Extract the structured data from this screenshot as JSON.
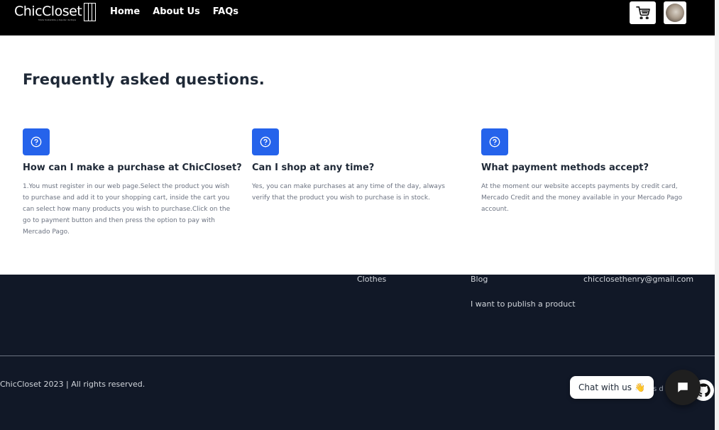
{
  "header": {
    "logo_text": "ChicCloset",
    "logo_subtitle": "Moda Sostenible y Alquiler de Ropa",
    "nav": [
      {
        "label": "Home"
      },
      {
        "label": "About Us"
      },
      {
        "label": "FAQs"
      }
    ],
    "cart_icon": "cart-icon",
    "avatar": "user-avatar"
  },
  "faq": {
    "title": "Frequently asked questions.",
    "items": [
      {
        "icon": "question-circle-icon",
        "question": "How can I make a purchase at ChicCloset?",
        "answer": "1.You must register in our web page.Select the product you wish to purchase and add it to your shopping cart, inside the cart you can select how many products you wish to purchase.Click on the go to payment button and then press the option to pay with Mercado Pago."
      },
      {
        "icon": "question-circle-icon",
        "question": "Can I shop at any time?",
        "answer": "Yes, you can make purchases at any time of the day, always verify that the product you wish to purchase is in stock."
      },
      {
        "icon": "question-circle-icon",
        "question": "What payment methods accept?",
        "answer": "At the moment our website accepts payments by credit card, Mercado Credit and the money available in your Mercado Pago account."
      }
    ]
  },
  "footer": {
    "links": {
      "clothes": "Clothes",
      "blog": "Blog",
      "publish": "I want to publish a product",
      "email": "chicclosethenry@gmail.com"
    },
    "copyright": "ChicCloset 2023 | All rights reserved.",
    "partial_text": "s d"
  },
  "chat": {
    "label": "Chat with us",
    "emoji": "👋"
  },
  "colors": {
    "header_bg": "#000000",
    "accent": "#2563eb",
    "footer_bg": "#111827",
    "heading": "#1f2937"
  }
}
